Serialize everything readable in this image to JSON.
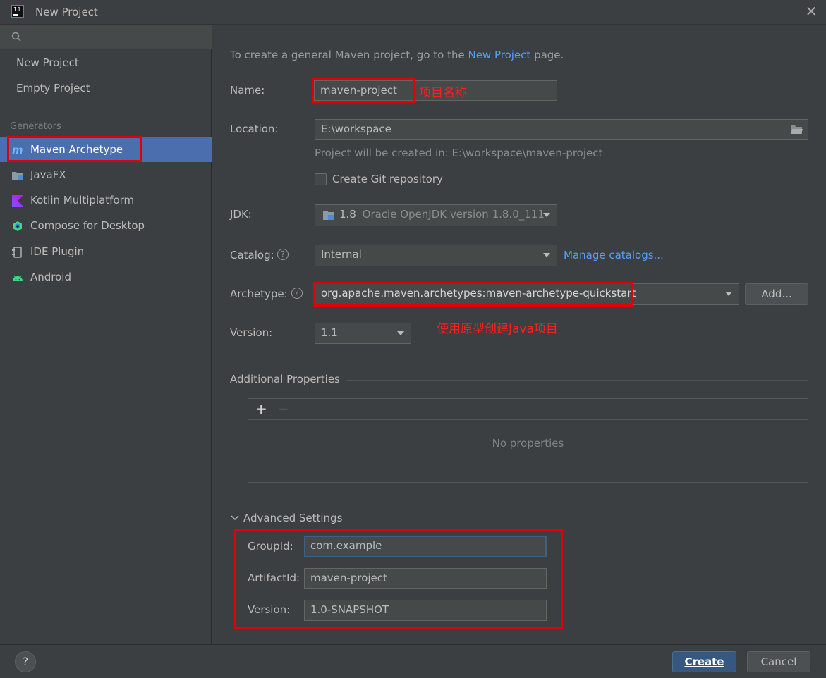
{
  "window": {
    "title": "New Project",
    "close_glyph": "✕"
  },
  "sidebar": {
    "search_icon": "search-icon",
    "top_items": [
      {
        "label": "New Project"
      },
      {
        "label": "Empty Project"
      }
    ],
    "group_label": "Generators",
    "generators": [
      {
        "label": "Maven Archetype",
        "icon": "maven-icon",
        "selected": true
      },
      {
        "label": "JavaFX",
        "icon": "javafx-folder-icon"
      },
      {
        "label": "Kotlin Multiplatform",
        "icon": "kotlin-icon"
      },
      {
        "label": "Compose for Desktop",
        "icon": "compose-icon"
      },
      {
        "label": "IDE Plugin",
        "icon": "plugin-icon"
      },
      {
        "label": "Android",
        "icon": "android-icon"
      }
    ]
  },
  "main": {
    "intro": {
      "prefix": "To create a general Maven project, go to the ",
      "link": "New Project",
      "suffix": " page."
    },
    "name": {
      "label": "Name:",
      "value": "maven-project",
      "annotation": "项目名称"
    },
    "location": {
      "label": "Location:",
      "value": "E:\\workspace",
      "hint": "Project will be created in: E:\\workspace\\maven-project"
    },
    "git": {
      "label": "Create Git repository",
      "checked": false
    },
    "jdk": {
      "label": "JDK:",
      "version": "1.8",
      "detail": "Oracle OpenJDK version 1.8.0_111"
    },
    "catalog": {
      "label": "Catalog:",
      "value": "Internal",
      "manage_link": "Manage catalogs..."
    },
    "archetype": {
      "label": "Archetype:",
      "value": "org.apache.maven.archetypes:maven-archetype-quickstart",
      "add_button": "Add...",
      "annotation": "使用原型创建Java项目"
    },
    "version": {
      "label": "Version:",
      "value": "1.1"
    },
    "additional_properties": {
      "title": "Additional Properties",
      "add_glyph": "+",
      "remove_glyph": "−",
      "empty_text": "No properties"
    },
    "advanced": {
      "title": "Advanced Settings",
      "group_id": {
        "label": "GroupId:",
        "value": "com.example"
      },
      "artifact_id": {
        "label": "ArtifactId:",
        "value": "maven-project"
      },
      "version": {
        "label": "Version:",
        "value": "1.0-SNAPSHOT"
      }
    }
  },
  "footer": {
    "help_glyph": "?",
    "create_label": "Create",
    "cancel_label": "Cancel"
  },
  "colors": {
    "accent": "#4b6eaf",
    "link": "#589df6",
    "annotation_red": "#e0000a",
    "background": "#3c3f41",
    "field": "#45494a"
  }
}
